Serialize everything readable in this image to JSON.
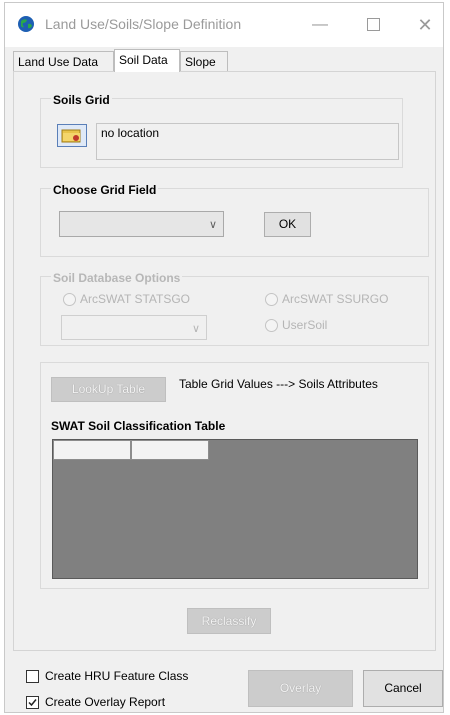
{
  "window": {
    "title": "Land Use/Soils/Slope Definition",
    "minimize_icon": "minimize-icon",
    "maximize_icon": "maximize-icon",
    "close_icon": "close-icon"
  },
  "tabs": [
    {
      "label": "Land Use Data",
      "active": false
    },
    {
      "label": "Soil Data",
      "active": true
    },
    {
      "label": "Slope",
      "active": false
    }
  ],
  "soils_grid": {
    "title": "Soils Grid",
    "location_text": "no location",
    "icon": "folder-open-icon"
  },
  "choose_grid_field": {
    "title": "Choose Grid Field",
    "selected_value": "",
    "ok_label": "OK"
  },
  "soil_db_options": {
    "title": "Soil Database Options",
    "statsgo_label": "ArcSWAT STATSGO",
    "ssurgo_label": "ArcSWAT SSURGO",
    "usersoil_label": "UserSoil",
    "selected_value": ""
  },
  "lookup": {
    "button_label": "LookUp Table",
    "description": "Table Grid Values ---> Soils Attributes",
    "table_title": "SWAT Soil Classification Table",
    "columns": [
      "",
      ""
    ]
  },
  "reclassify_label": "Reclassify",
  "footer": {
    "create_hru_label": "Create HRU Feature Class",
    "create_hru_checked": false,
    "create_overlay_label": "Create Overlay Report",
    "create_overlay_checked": true,
    "overlay_label": "Overlay",
    "cancel_label": "Cancel"
  }
}
